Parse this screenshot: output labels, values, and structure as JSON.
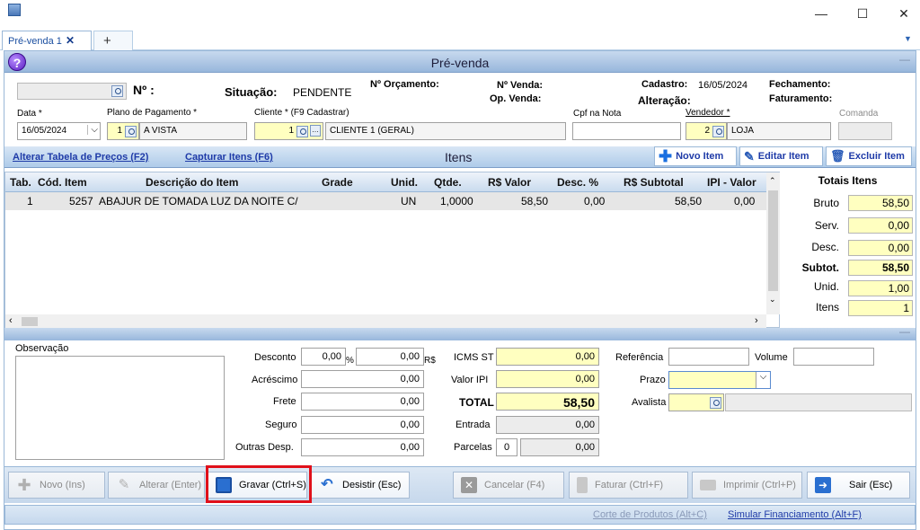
{
  "window": {
    "minimize": "—",
    "maximize": "☐",
    "close": "✕"
  },
  "tabs": {
    "tab1": "Pré-venda 1",
    "tab1_close": "✕",
    "add": "+",
    "menu": "▼"
  },
  "header": {
    "title": "Pré-venda",
    "help": "?",
    "collapse": "—"
  },
  "form": {
    "numero_label": "Nº :",
    "situacao_label": "Situação:",
    "situacao_value": "PENDENTE",
    "orcamento_label": "Nº Orçamento:",
    "venda_label": "Nº Venda:",
    "opvenda_label": "Op. Venda:",
    "cadastro_label": "Cadastro:",
    "cadastro_value": "16/05/2024",
    "alteracao_label": "Alteração:",
    "fechamento_label": "Fechamento:",
    "faturamento_label": "Faturamento:",
    "data_label": "Data *",
    "data_value": "16/05/2024",
    "plano_label": "Plano de Pagamento *",
    "plano_code": "1",
    "plano_value": "A VISTA",
    "cliente_label": "Cliente * (F9 Cadastrar)",
    "cliente_code": "1",
    "cliente_value": "CLIENTE 1 (GERAL)",
    "cpf_label": "Cpf na Nota",
    "vendedor_label": "Vendedor *",
    "vendedor_code": "2",
    "vendedor_value": "LOJA",
    "comanda_label": "Comanda"
  },
  "itens_bar": {
    "alterar_tabela": "Alterar Tabela de Preços (F2)",
    "capturar": "Capturar Itens (F6)",
    "title": "Itens",
    "novo": "Novo Item",
    "editar": "Editar Item",
    "excluir": "Excluir Item"
  },
  "grid": {
    "columns": [
      "Tab.",
      "Cód. Item",
      "Descrição do Item",
      "Grade",
      "Unid.",
      "Qtde.",
      "R$ Valor",
      "Desc. %",
      "R$ Subtotal",
      "IPI - Valor"
    ],
    "rows": [
      [
        "1",
        "5257",
        "ABAJUR DE TOMADA  LUZ DA NOITE C/",
        "",
        "UN",
        "1,0000",
        "58,50",
        "0,00",
        "58,50",
        "0,00"
      ]
    ]
  },
  "totais": {
    "title": "Totais Itens",
    "bruto_label": "Bruto",
    "bruto": "58,50",
    "serv_label": "Serv.",
    "serv": "0,00",
    "desc_label": "Desc.",
    "desc": "0,00",
    "subtot_label": "Subtot.",
    "subtot": "58,50",
    "unid_label": "Unid.",
    "unid": "1,00",
    "itens_label": "Itens",
    "itens": "1"
  },
  "bottom": {
    "observacao_label": "Observação",
    "desconto_label": "Desconto",
    "desconto_pct": "0,00",
    "pct_sign": "%",
    "desconto_val": "0,00",
    "rs": "R$",
    "acrescimo_label": "Acréscimo",
    "acrescimo": "0,00",
    "frete_label": "Frete",
    "frete": "0,00",
    "seguro_label": "Seguro",
    "seguro": "0,00",
    "outras_label": "Outras Desp.",
    "outras": "0,00",
    "icms_label": "ICMS ST",
    "icms": "0,00",
    "ipi_label": "Valor IPI",
    "ipi": "0,00",
    "total_label": "TOTAL",
    "total": "58,50",
    "entrada_label": "Entrada",
    "entrada": "0,00",
    "parcelas_label": "Parcelas",
    "parcelas_n": "0",
    "parcelas": "0,00",
    "referencia_label": "Referência",
    "volume_label": "Volume",
    "prazo_label": "Prazo",
    "avalista_label": "Avalista"
  },
  "buttons": {
    "novo": "Novo (Ins)",
    "alterar": "Alterar (Enter)",
    "gravar": "Gravar (Ctrl+S)",
    "desistir": "Desistir (Esc)",
    "cancelar": "Cancelar (F4)",
    "faturar": "Faturar (Ctrl+F)",
    "imprimir": "Imprimir (Ctrl+P)",
    "sair": "Sair (Esc)"
  },
  "status": {
    "corte": "Corte de Produtos (Alt+C)",
    "simular": "Simular Financiamento (Alt+F)"
  },
  "colors": {
    "accent": "#1f3ba8",
    "highlight": "#e0101a",
    "yellow": "#ffffc0"
  }
}
